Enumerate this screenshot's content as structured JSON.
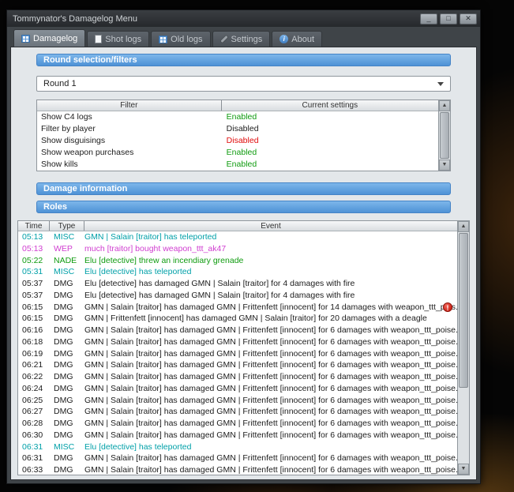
{
  "window": {
    "title": "Tommynator's Damagelog Menu",
    "controls": {
      "minimize": "_",
      "maximize": "□",
      "close": "✕"
    }
  },
  "tabs": [
    {
      "id": "damagelog",
      "label": "Damagelog",
      "icon": "grid",
      "active": true
    },
    {
      "id": "shot-logs",
      "label": "Shot logs",
      "icon": "page",
      "active": false
    },
    {
      "id": "old-logs",
      "label": "Old logs",
      "icon": "grid",
      "active": false
    },
    {
      "id": "settings",
      "label": "Settings",
      "icon": "wrench",
      "active": false
    },
    {
      "id": "about",
      "label": "About",
      "icon": "info",
      "active": false
    }
  ],
  "sections": {
    "round_filters": "Round selection/filters",
    "damage_info": "Damage information",
    "roles": "Roles"
  },
  "round_select": {
    "value": "Round 1"
  },
  "filter_table": {
    "headers": [
      "Filter",
      "Current settings"
    ],
    "rows": [
      {
        "filter": "Show C4 logs",
        "setting": "Enabled",
        "color": "green"
      },
      {
        "filter": "Filter by player",
        "setting": "Disabled",
        "color": "black"
      },
      {
        "filter": "Show disguisings",
        "setting": "Disabled",
        "color": "red"
      },
      {
        "filter": "Show weapon purchases",
        "setting": "Enabled",
        "color": "green"
      },
      {
        "filter": "Show kills",
        "setting": "Enabled",
        "color": "green"
      }
    ]
  },
  "log_table": {
    "headers": [
      "Time",
      "Type",
      "Event"
    ],
    "rows": [
      {
        "time": "05:13",
        "type": "MISC",
        "event": "GMN | Salain [traitor] has teleported",
        "color": "teal"
      },
      {
        "time": "05:13",
        "type": "WEP",
        "event": "much [traitor] bought weapon_ttt_ak47",
        "color": "magenta"
      },
      {
        "time": "05:22",
        "type": "NADE",
        "event": "Elu [detective] threw an incendiary grenade",
        "color": "green"
      },
      {
        "time": "05:31",
        "type": "MISC",
        "event": "Elu [detective] has teleported",
        "color": "teal"
      },
      {
        "time": "05:37",
        "type": "DMG",
        "event": "Elu [detective] has damaged GMN | Salain [traitor] for 4 damages with fire",
        "color": "black"
      },
      {
        "time": "05:37",
        "type": "DMG",
        "event": "Elu [detective] has damaged GMN | Salain [traitor] for 4 damages with fire",
        "color": "black"
      },
      {
        "time": "06:15",
        "type": "DMG",
        "event": "GMN | Salain [traitor] has damaged GMN | Frittenfett [innocent] for 14 damages with weapon_ttt_pois...",
        "color": "black",
        "alert": true
      },
      {
        "time": "06:15",
        "type": "DMG",
        "event": "GMN | Frittenfett [innocent] has damaged GMN | Salain [traitor] for 20 damages with a deagle",
        "color": "black"
      },
      {
        "time": "06:16",
        "type": "DMG",
        "event": "GMN | Salain [traitor] has damaged GMN | Frittenfett [innocent] for 6 damages with weapon_ttt_poise...",
        "color": "black"
      },
      {
        "time": "06:18",
        "type": "DMG",
        "event": "GMN | Salain [traitor] has damaged GMN | Frittenfett [innocent] for 6 damages with weapon_ttt_poise...",
        "color": "black"
      },
      {
        "time": "06:19",
        "type": "DMG",
        "event": "GMN | Salain [traitor] has damaged GMN | Frittenfett [innocent] for 6 damages with weapon_ttt_poise...",
        "color": "black"
      },
      {
        "time": "06:21",
        "type": "DMG",
        "event": "GMN | Salain [traitor] has damaged GMN | Frittenfett [innocent] for 6 damages with weapon_ttt_poise...",
        "color": "black"
      },
      {
        "time": "06:22",
        "type": "DMG",
        "event": "GMN | Salain [traitor] has damaged GMN | Frittenfett [innocent] for 6 damages with weapon_ttt_poise...",
        "color": "black"
      },
      {
        "time": "06:24",
        "type": "DMG",
        "event": "GMN | Salain [traitor] has damaged GMN | Frittenfett [innocent] for 6 damages with weapon_ttt_poise...",
        "color": "black"
      },
      {
        "time": "06:25",
        "type": "DMG",
        "event": "GMN | Salain [traitor] has damaged GMN | Frittenfett [innocent] for 6 damages with weapon_ttt_poise...",
        "color": "black"
      },
      {
        "time": "06:27",
        "type": "DMG",
        "event": "GMN | Salain [traitor] has damaged GMN | Frittenfett [innocent] for 6 damages with weapon_ttt_poise...",
        "color": "black"
      },
      {
        "time": "06:28",
        "type": "DMG",
        "event": "GMN | Salain [traitor] has damaged GMN | Frittenfett [innocent] for 6 damages with weapon_ttt_poise...",
        "color": "black"
      },
      {
        "time": "06:30",
        "type": "DMG",
        "event": "GMN | Salain [traitor] has damaged GMN | Frittenfett [innocent] for 6 damages with weapon_ttt_poise...",
        "color": "black"
      },
      {
        "time": "06:31",
        "type": "MISC",
        "event": "Elu [detective] has teleported",
        "color": "teal"
      },
      {
        "time": "06:31",
        "type": "DMG",
        "event": "GMN | Salain [traitor] has damaged GMN | Frittenfett [innocent] for 6 damages with weapon_ttt_poise...",
        "color": "black"
      },
      {
        "time": "06:33",
        "type": "DMG",
        "event": "GMN | Salain [traitor] has damaged GMN | Frittenfett [innocent] for 6 damages with weapon_ttt_poise...",
        "color": "black"
      }
    ]
  },
  "colors": {
    "section_header": "#4e92d6",
    "enabled": "#0f9b0f",
    "disabled_red": "#e00b0b",
    "misc": "#00a0a8",
    "wep": "#d03ed0",
    "nade": "#0f9b0f",
    "alert": "#cf2318"
  }
}
